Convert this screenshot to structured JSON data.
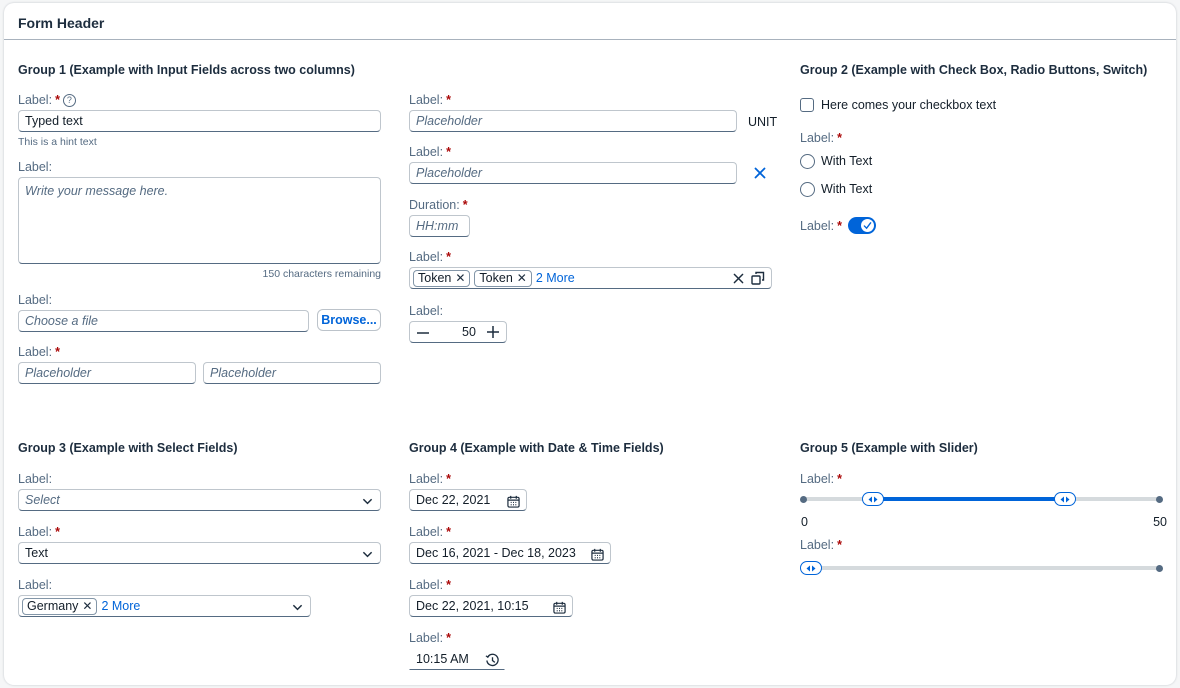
{
  "form": {
    "title": "Form Header"
  },
  "group1": {
    "title": "Group 1 (Example with Input Fields across two columns)",
    "field1_label": "Label:",
    "field1_value": "Typed text",
    "field1_hint": "This is a hint text",
    "textarea_label": "Label:",
    "textarea_placeholder": "Write your message here.",
    "textarea_counter": "150 characters remaining",
    "file_label": "Label:",
    "file_placeholder": "Choose a file",
    "browse_label": "Browse...",
    "pair_label": "Label:",
    "pair_placeholder1": "Placeholder",
    "pair_placeholder2": "Placeholder",
    "unit_label": "Label:",
    "unit_placeholder": "Placeholder",
    "unit_text": "UNIT",
    "clear_label": "Label:",
    "clear_placeholder": "Placeholder",
    "duration_label": "Duration:",
    "duration_placeholder": "HH:mm",
    "multi_label": "Label:",
    "tokens": [
      "Token",
      "Token"
    ],
    "tokens_more": "2 More",
    "stepper_label": "Label:",
    "stepper_value": "50"
  },
  "group2": {
    "title": "Group 2 (Example with Check Box, Radio Buttons, Switch)",
    "checkbox_text": "Here comes your checkbox text",
    "radio_label": "Label:",
    "radio1": "With Text",
    "radio2": "With Text",
    "switch_label": "Label:"
  },
  "group3": {
    "title": "Group 3 (Example with Select Fields)",
    "select1_label": "Label:",
    "select1_placeholder": "Select",
    "select2_label": "Label:",
    "select2_value": "Text",
    "select3_label": "Label:",
    "select3_token": "Germany",
    "select3_more": "2 More"
  },
  "group4": {
    "title": "Group 4 (Example with Date & Time Fields)",
    "date_label": "Label:",
    "date_value": "Dec 22, 2021",
    "range_label": "Label:",
    "range_value": "Dec 16, 2021 - Dec 18, 2023",
    "datetime_label": "Label:",
    "datetime_value": "Dec 22, 2021, 10:15",
    "time_label": "Label:",
    "time_value": "10:15 AM"
  },
  "group5": {
    "title": "Group 5 (Example with Slider)",
    "slider1_label": "Label:",
    "slider1_min": "0",
    "slider1_max": "50",
    "slider1_low": 0.2,
    "slider1_high": 0.73,
    "slider2_label": "Label:",
    "slider2_value": 0.0
  },
  "colors": {
    "accent": "#0064d9",
    "required": "#aa0808",
    "label": "#556b82"
  },
  "icons": [
    "help-icon",
    "clear-icon",
    "value-help-icon",
    "minus-icon",
    "plus-icon",
    "chevron-down-icon",
    "calendar-icon",
    "time-icon",
    "check-icon",
    "slider-handle-icon"
  ]
}
